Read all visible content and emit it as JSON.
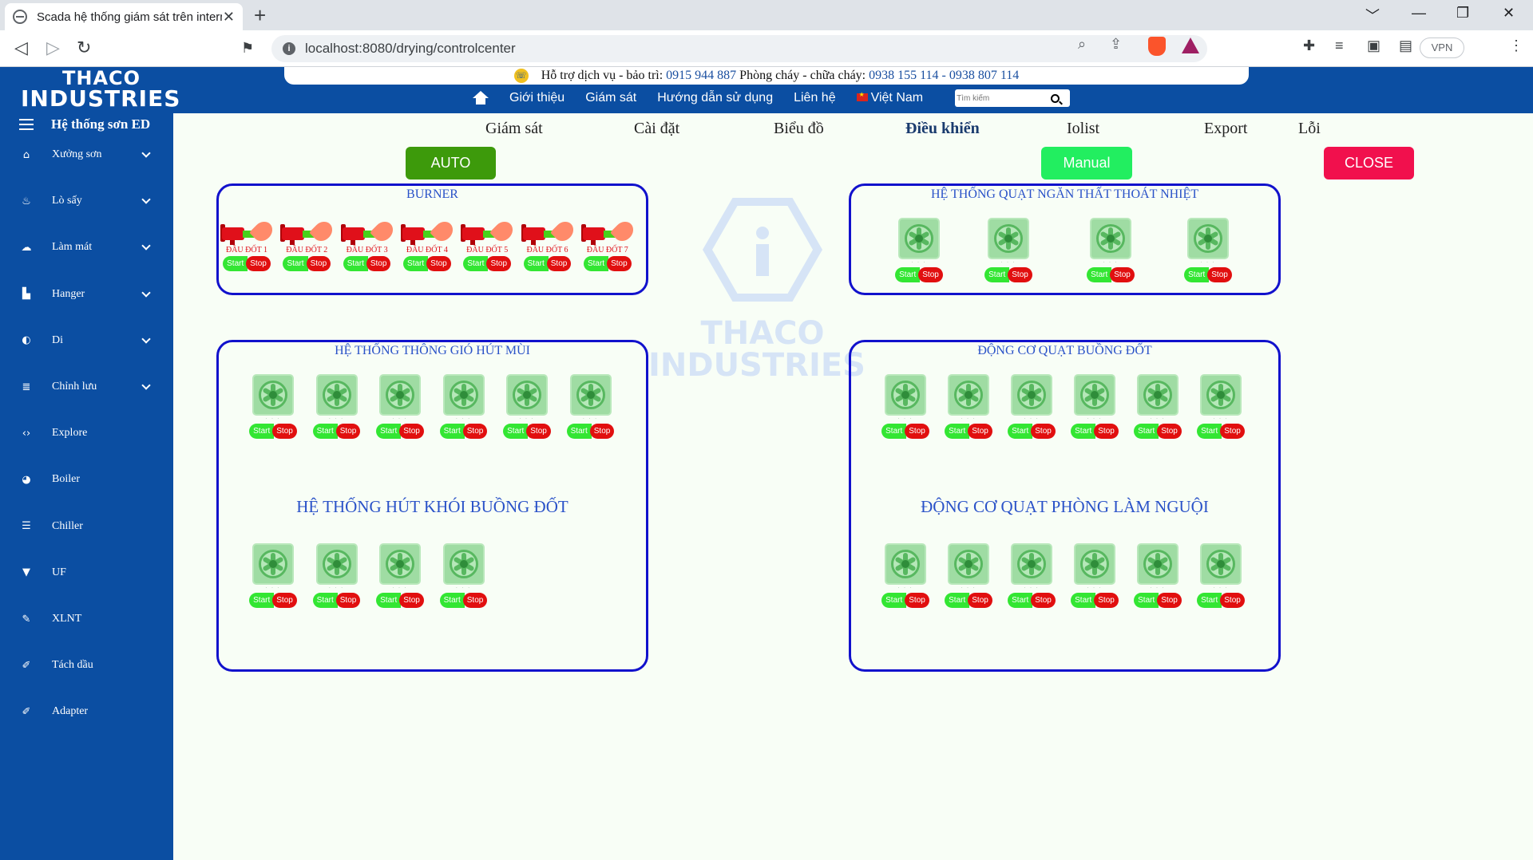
{
  "browser": {
    "tab_title": "Scada hệ thống giám sát trên internet",
    "tab_close": "✕",
    "new_tab": "+",
    "url": "localhost:8080/drying/controlcenter",
    "vpn": "VPN",
    "window_controls": [
      "﹀",
      "—",
      "❐",
      "✕"
    ]
  },
  "header": {
    "logo_line1": "THACO",
    "logo_line2": "INDUSTRIES",
    "support_text": "Hỗ trợ dịch vụ - bảo trì:",
    "support_phone": "0915 944 887",
    "fire_text": "Phòng cháy - chữa cháy:",
    "fire_phones": "0938 155 114 - 0938 807 114",
    "nav": [
      "Giới thiệu",
      "Giám sát",
      "Hướng dẫn sử dụng",
      "Liên hệ"
    ],
    "language": "Việt Nam",
    "search_placeholder": "Tìm kiếm"
  },
  "sidebar": {
    "title": "Hệ thống sơn ED",
    "items": [
      {
        "label": "Xưởng sơn",
        "icon": "home-icon",
        "glyph": "⌂",
        "expandable": true
      },
      {
        "label": "Lò sấy",
        "icon": "fire-icon",
        "glyph": "♨",
        "expandable": true
      },
      {
        "label": "Làm mát",
        "icon": "cloud-icon",
        "glyph": "☁",
        "expandable": true
      },
      {
        "label": "Hanger",
        "icon": "map-icon",
        "glyph": "▙",
        "expandable": true
      },
      {
        "label": "Di",
        "icon": "drop-icon",
        "glyph": "◐",
        "expandable": true
      },
      {
        "label": "Chỉnh lưu",
        "icon": "database-icon",
        "glyph": "≣",
        "expandable": true
      },
      {
        "label": "Explore",
        "icon": "code-icon",
        "glyph": "‹›",
        "expandable": false
      },
      {
        "label": "Boiler",
        "icon": "water-icon",
        "glyph": "◕",
        "expandable": false
      },
      {
        "label": "Chiller",
        "icon": "chiller-icon",
        "glyph": "☰",
        "expandable": false
      },
      {
        "label": "UF",
        "icon": "filter-icon",
        "glyph": "▼",
        "expandable": false
      },
      {
        "label": "XLNT",
        "icon": "brush-icon",
        "glyph": "✎",
        "expandable": false
      },
      {
        "label": "Tách dầu",
        "icon": "pen-icon",
        "glyph": "✐",
        "expandable": false
      },
      {
        "label": "Adapter",
        "icon": "pencil-icon",
        "glyph": "✐",
        "expandable": false
      }
    ]
  },
  "subnav": [
    "Giám sát",
    "Cài đặt",
    "Biểu đồ",
    "Điều khiển",
    "Iolist",
    "Export",
    "Lỗi"
  ],
  "active_subnav": "Điều khiển",
  "mode_buttons": {
    "auto": "AUTO",
    "manual": "Manual",
    "close": "CLOSE"
  },
  "watermark": {
    "line1": "THACO",
    "line2": "INDUSTRIES"
  },
  "controls": {
    "start": "Start",
    "stop": "Stop"
  },
  "panels": {
    "burner": {
      "title": "BURNER",
      "devices": [
        "ĐẦU ĐỐT 1",
        "ĐẦU ĐỐT 2",
        "ĐẦU ĐỐT 3",
        "ĐẦU ĐỐT 4",
        "ĐẦU ĐỐT 5",
        "ĐẦU ĐỐT 6",
        "ĐẦU ĐỐT 7"
      ]
    },
    "exhaust_room": {
      "title": "HỆ THỐNG QUẠT NGĂN THẤT THOÁT NHIỆT",
      "count": 4
    },
    "ventilation": {
      "title": "HỆ THỐNG THÔNG GIÓ HÚT MÙI",
      "count": 6,
      "subtitle": "HỆ THỐNG HÚT KHÓI BUỒNG ĐỐT",
      "sub_count": 4
    },
    "chamber_fans": {
      "title": "ĐỘNG CƠ QUẠT BUỒNG ĐỐT",
      "count": 6,
      "subtitle": "ĐỘNG CƠ QUẠT PHÒNG LÀM NGUỘI",
      "sub_count": 6
    }
  }
}
